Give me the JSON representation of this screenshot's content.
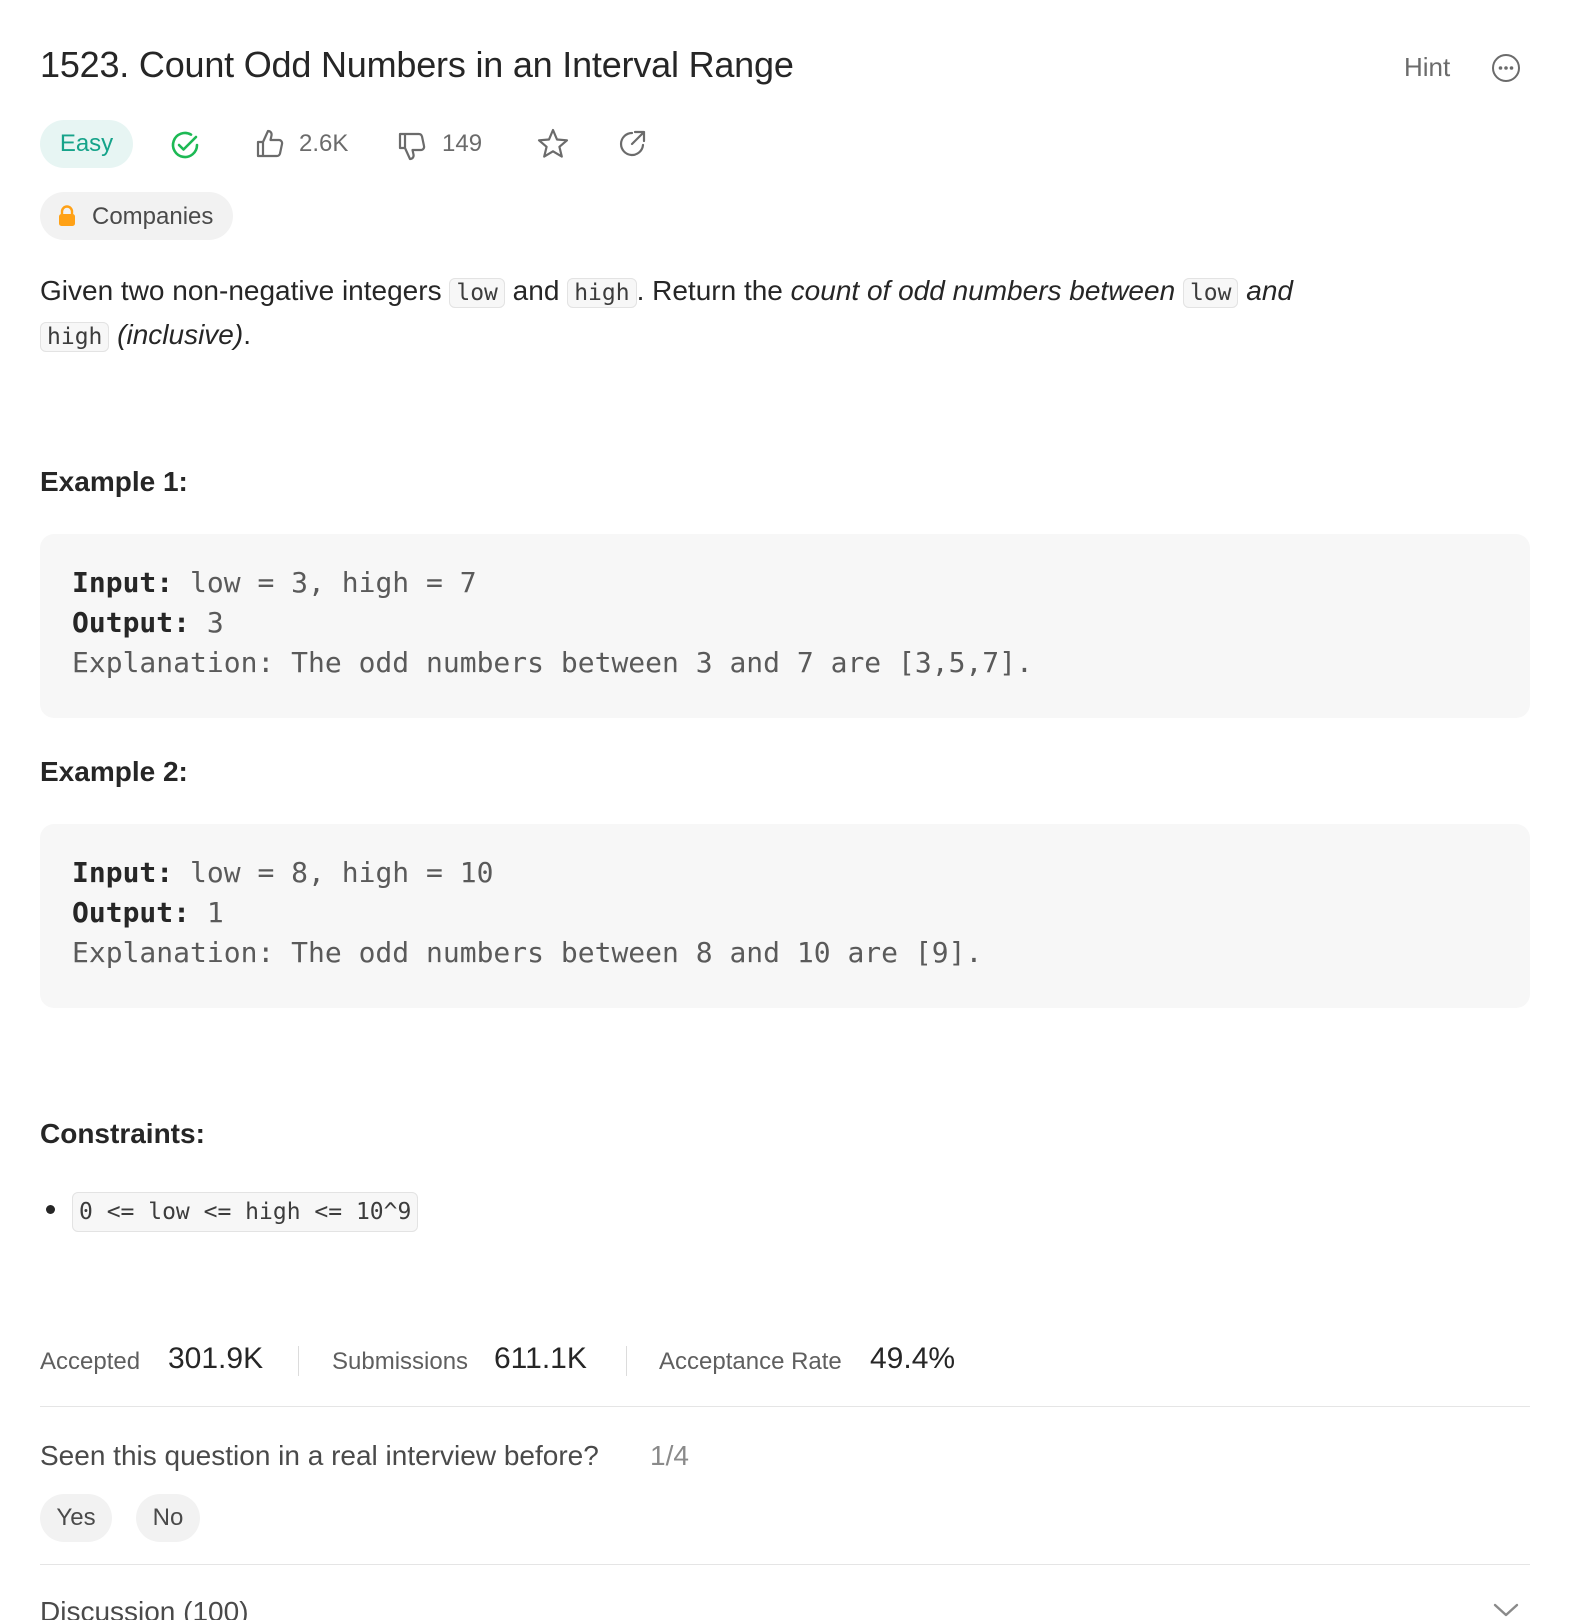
{
  "header": {
    "title": "1523. Count Odd Numbers in an Interval Range",
    "hint_label": "Hint"
  },
  "meta": {
    "difficulty": "Easy",
    "likes": "2.6K",
    "dislikes": "149"
  },
  "companies_label": "Companies",
  "description": {
    "p1": "Given two non-negative integers ",
    "code_low": "low",
    "p2": " and ",
    "code_high": "high",
    "p3": ". Return the ",
    "em1": "count of odd numbers between ",
    "code_low2": "low",
    "em2": " and",
    "code_high2": "high",
    "em3": "(inclusive)",
    "p4": "."
  },
  "examples": [
    {
      "title": "Example 1:",
      "input_label": "Input:",
      "input_value": " low = 3, high = 7",
      "output_label": "Output:",
      "output_value": " 3",
      "explanation": "Explanation: The odd numbers between 3 and 7 are [3,5,7]."
    },
    {
      "title": "Example 2:",
      "input_label": "Input:",
      "input_value": " low = 8, high = 10",
      "output_label": "Output:",
      "output_value": " 1",
      "explanation": "Explanation: The odd numbers between 8 and 10 are [9]."
    }
  ],
  "constraints": {
    "title": "Constraints:",
    "items": [
      "0 <= low <= high <= 10^9"
    ]
  },
  "stats": {
    "accepted_label": "Accepted",
    "accepted_value": "301.9K",
    "submissions_label": "Submissions",
    "submissions_value": "611.1K",
    "rate_label": "Acceptance Rate",
    "rate_value": "49.4%"
  },
  "interview": {
    "question": "Seen this question in a real interview before?",
    "count": "1/4",
    "yes": "Yes",
    "no": "No"
  },
  "discussion_label": "Discussion (100)",
  "colors": {
    "easy_text": "#16a38a",
    "easy_bg": "#e7f5f3",
    "solved_check": "#1db954",
    "lock": "#ffa116"
  }
}
